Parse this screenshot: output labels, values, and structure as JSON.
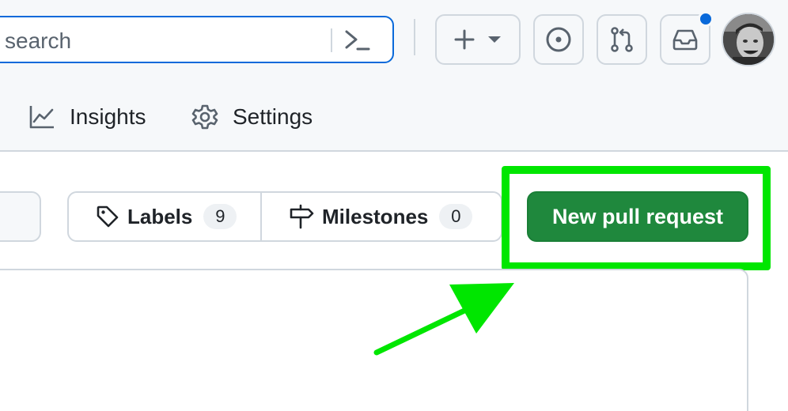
{
  "header": {
    "search_placeholder": "search",
    "icons": [
      "terminal-prompt-icon",
      "plus-icon",
      "triangle-down-icon",
      "issue-opened-icon",
      "git-pull-request-icon",
      "inbox-icon"
    ]
  },
  "tabs": [
    {
      "label": "Insights",
      "icon": "graph-icon"
    },
    {
      "label": "Settings",
      "icon": "gear-icon"
    }
  ],
  "toolbar": {
    "labels": {
      "label": "Labels",
      "count": "9",
      "icon": "tag-icon"
    },
    "milestones": {
      "label": "Milestones",
      "count": "0",
      "icon": "milestone-icon"
    },
    "new_pull_request": "New pull request"
  },
  "colors": {
    "accent": "#0969da",
    "primary_button": "#1f883d",
    "annotation": "#00e600"
  }
}
